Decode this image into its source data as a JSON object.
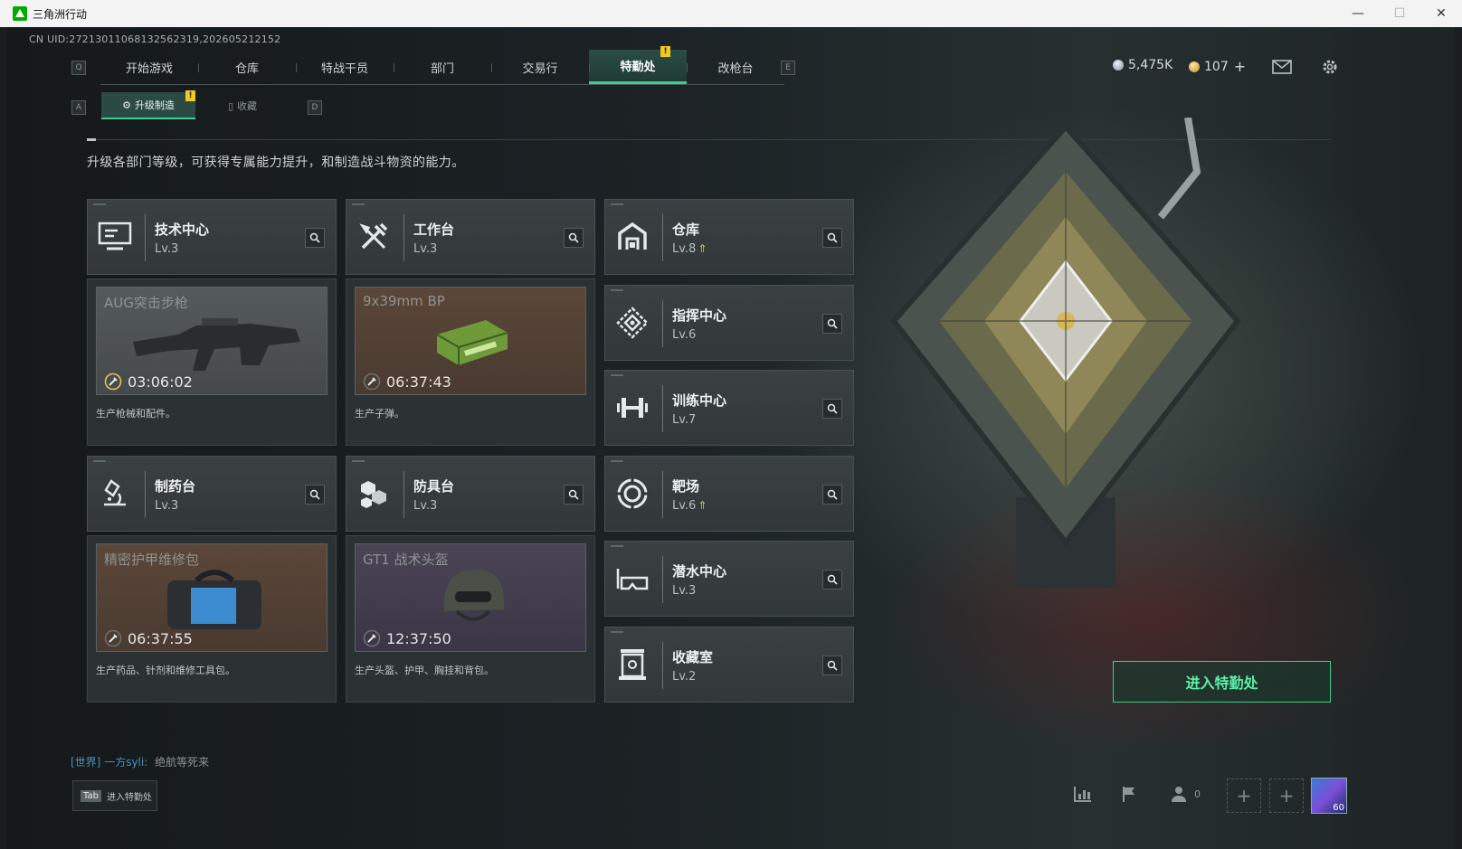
{
  "window": {
    "title": "三角洲行动",
    "minimize": "—",
    "maximize": "☐",
    "close": "✕"
  },
  "uid": "CN UID:2721301106813256231​9,202605212152",
  "topnav": {
    "key_left": "Q",
    "key_right": "E",
    "tabs": [
      "开始游戏",
      "仓库",
      "特战干员",
      "部门",
      "交易行",
      "特勤处",
      "改枪台"
    ],
    "active": "特勤处",
    "badge": "!"
  },
  "currency": {
    "silver": "5,475K",
    "gold": "107",
    "plus": "+"
  },
  "subnav": {
    "key_left": "A",
    "key_right": "D",
    "tabs": [
      "升级制造",
      "收藏"
    ],
    "active": "升级制造",
    "badge": "!"
  },
  "description": "升级各部门等级，可获得专属能力提升，和制造战斗物资的能力。",
  "facilities": [
    {
      "name": "技术中心",
      "level": "Lv.3",
      "upgradable": false,
      "icon": "monitor-icon"
    },
    {
      "name": "工作台",
      "level": "Lv.3",
      "upgradable": false,
      "icon": "tools-icon"
    },
    {
      "name": "仓库",
      "level": "Lv.8",
      "upgradable": true,
      "icon": "warehouse-icon"
    },
    {
      "name": "指挥中心",
      "level": "Lv.6",
      "upgradable": false,
      "icon": "command-icon"
    },
    {
      "name": "训练中心",
      "level": "Lv.7",
      "upgradable": false,
      "icon": "dumbbell-icon"
    },
    {
      "name": "制药台",
      "level": "Lv.3",
      "upgradable": false,
      "icon": "microscope-icon"
    },
    {
      "name": "防具台",
      "level": "Lv.3",
      "upgradable": false,
      "icon": "armor-icon"
    },
    {
      "name": "靶场",
      "level": "Lv.6",
      "upgradable": true,
      "icon": "target-icon"
    },
    {
      "name": "潜水中心",
      "level": "Lv.3",
      "upgradable": false,
      "icon": "goggles-icon"
    },
    {
      "name": "收藏室",
      "level": "Lv.2",
      "upgradable": false,
      "icon": "collection-icon"
    }
  ],
  "productions": [
    {
      "item": "AUG突击步枪",
      "timer": "03:06:02",
      "desc": "生产枪械和配件。"
    },
    {
      "item": "9x39mm BP",
      "timer": "06:37:43",
      "desc": "生产子弹。"
    },
    {
      "item": "精密护甲维修包",
      "timer": "06:37:55",
      "desc": "生产药品、针剂和维修工具包。"
    },
    {
      "item": "GT1 战术头盔",
      "timer": "12:37:50",
      "desc": "生产头盔、护甲、胸挂和背包。"
    }
  ],
  "enter_button": "进入特勤处",
  "chat": {
    "channel": "[世界]",
    "user": "一方syli:",
    "message": "绝航等死来"
  },
  "tab_hint": {
    "key": "Tab",
    "label": "进入特勤处"
  },
  "friends_count": "0",
  "avatar_level": "60",
  "colors": {
    "accent": "#3ad08a",
    "badge": "#f2c91c",
    "upgrade": "#e2c45a"
  }
}
